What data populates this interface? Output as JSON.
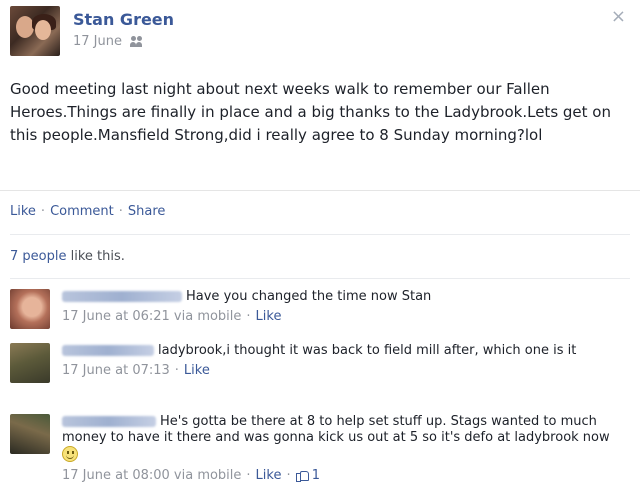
{
  "post": {
    "author": "Stan Green",
    "date": "17 June",
    "audience_icon": "friends-icon",
    "close_label": "×",
    "text": "Good meeting last night about next weeks walk to remember our Fallen Heroes.Things are finally in place and a big thanks to the Ladybrook.Lets get on this people.Mansfield Strong,did i really agree to 8 Sunday morning?lol"
  },
  "actions": {
    "like": "Like",
    "comment": "Comment",
    "share": "Share",
    "separator": "·"
  },
  "likes": {
    "people": "7 people",
    "suffix": " like this."
  },
  "comments": [
    {
      "text": "Have you changed the time now Stan",
      "time": "17 June at 06:21 via mobile",
      "like": "Like"
    },
    {
      "text": "ladybrook,i thought it was back to field mill after, which one is it",
      "time": "17 June at 07:13",
      "like": "Like"
    },
    {
      "text": "He's gotta be there at 8 to help set stuff up. Stags wanted to much money to have it there and was gonna kick us out at 5 so it's defo at ladybrook now",
      "time": "17 June at 08:00 via mobile",
      "like": "Like",
      "like_count": "1"
    }
  ],
  "colors": {
    "link": "#3b5998",
    "meta": "#90949c",
    "divider": "#e5e5e5"
  }
}
